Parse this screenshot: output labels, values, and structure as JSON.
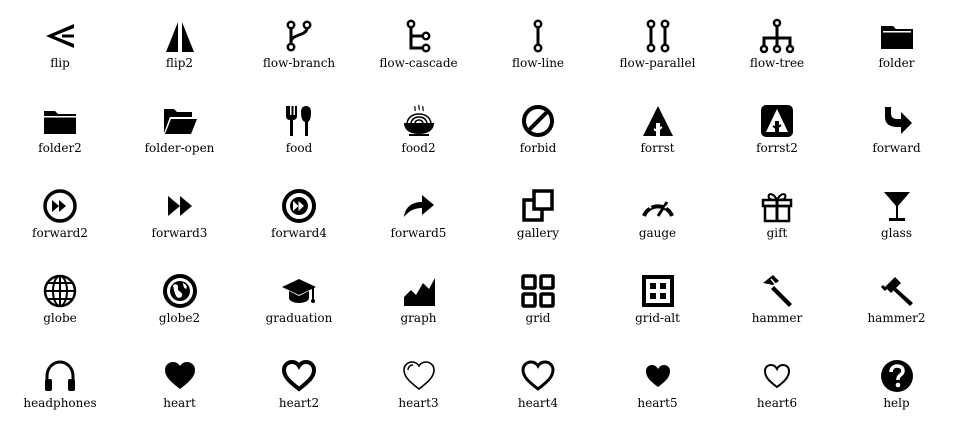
{
  "icons": [
    {
      "name": "flip",
      "label": "flip"
    },
    {
      "name": "flip2",
      "label": "flip2"
    },
    {
      "name": "flow-branch",
      "label": "flow-branch"
    },
    {
      "name": "flow-cascade",
      "label": "flow-cascade"
    },
    {
      "name": "flow-line",
      "label": "flow-line"
    },
    {
      "name": "flow-parallel",
      "label": "flow-parallel"
    },
    {
      "name": "flow-tree",
      "label": "flow-tree"
    },
    {
      "name": "folder",
      "label": "folder"
    },
    {
      "name": "folder2",
      "label": "folder2"
    },
    {
      "name": "folder-open",
      "label": "folder-open"
    },
    {
      "name": "food",
      "label": "food"
    },
    {
      "name": "food2",
      "label": "food2"
    },
    {
      "name": "forbid",
      "label": "forbid"
    },
    {
      "name": "forrst",
      "label": "forrst"
    },
    {
      "name": "forrst2",
      "label": "forrst2"
    },
    {
      "name": "forward",
      "label": "forward"
    },
    {
      "name": "forward2",
      "label": "forward2"
    },
    {
      "name": "forward3",
      "label": "forward3"
    },
    {
      "name": "forward4",
      "label": "forward4"
    },
    {
      "name": "forward5",
      "label": "forward5"
    },
    {
      "name": "gallery",
      "label": "gallery"
    },
    {
      "name": "gauge",
      "label": "gauge"
    },
    {
      "name": "gift",
      "label": "gift"
    },
    {
      "name": "glass",
      "label": "glass"
    },
    {
      "name": "globe",
      "label": "globe"
    },
    {
      "name": "globe2",
      "label": "globe2"
    },
    {
      "name": "graduation",
      "label": "graduation"
    },
    {
      "name": "graph",
      "label": "graph"
    },
    {
      "name": "grid",
      "label": "grid"
    },
    {
      "name": "grid-alt",
      "label": "grid-alt"
    },
    {
      "name": "hammer",
      "label": "hammer"
    },
    {
      "name": "hammer2",
      "label": "hammer2"
    },
    {
      "name": "headphones",
      "label": "headphones"
    },
    {
      "name": "heart",
      "label": "heart"
    },
    {
      "name": "heart2",
      "label": "heart2"
    },
    {
      "name": "heart3",
      "label": "heart3"
    },
    {
      "name": "heart4",
      "label": "heart4"
    },
    {
      "name": "heart5",
      "label": "heart5"
    },
    {
      "name": "heart6",
      "label": "heart6"
    },
    {
      "name": "help",
      "label": "help"
    }
  ]
}
